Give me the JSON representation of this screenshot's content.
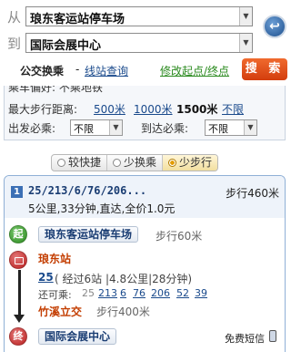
{
  "search": {
    "from_label": "从",
    "from_value": "琅东客运站停车场",
    "to_label": "到",
    "to_value": "国际会展中心",
    "tab_active": "公交换乘",
    "tab_separator": "-",
    "tab_other": "线站查询",
    "edit_link": "修改起点/终点",
    "search_button": "搜 索"
  },
  "options": {
    "partial_row": "乘车偏好: 不乘地铁",
    "max_walk_label": "最大步行距离:",
    "walk_options": [
      "500米",
      "1000米",
      "1500米",
      "不限"
    ],
    "selected_walk": "1500米",
    "depart_label": "出发必乘:",
    "depart_value": "不限",
    "arrive_label": "到达必乘:",
    "arrive_value": "不限"
  },
  "sort": {
    "items": [
      {
        "label": "较快捷",
        "active": false
      },
      {
        "label": "少换乘",
        "active": false
      },
      {
        "label": "少步行",
        "active": true
      }
    ]
  },
  "result": {
    "index": "1",
    "title": "25/213/6/76/206...",
    "walk_total": "步行460米",
    "summary": "5公里,33分钟,直达,全价1.0元",
    "start_icon": "起",
    "start_stop": "琅东客运站停车场",
    "start_walk": "步行60米",
    "board_station": "琅东站",
    "line": "25",
    "line_detail": "( 经过6站 |4.8公里|28分钟)",
    "alt_label": "还可乘:",
    "alt_first": "25",
    "alt_lines": [
      "213",
      "6",
      "76",
      "206",
      "52",
      "39"
    ],
    "alight_station": "竹溪立交",
    "alight_walk": "步行400米",
    "end_icon": "终",
    "end_stop": "国际会展中心",
    "sms": "免费短信"
  }
}
